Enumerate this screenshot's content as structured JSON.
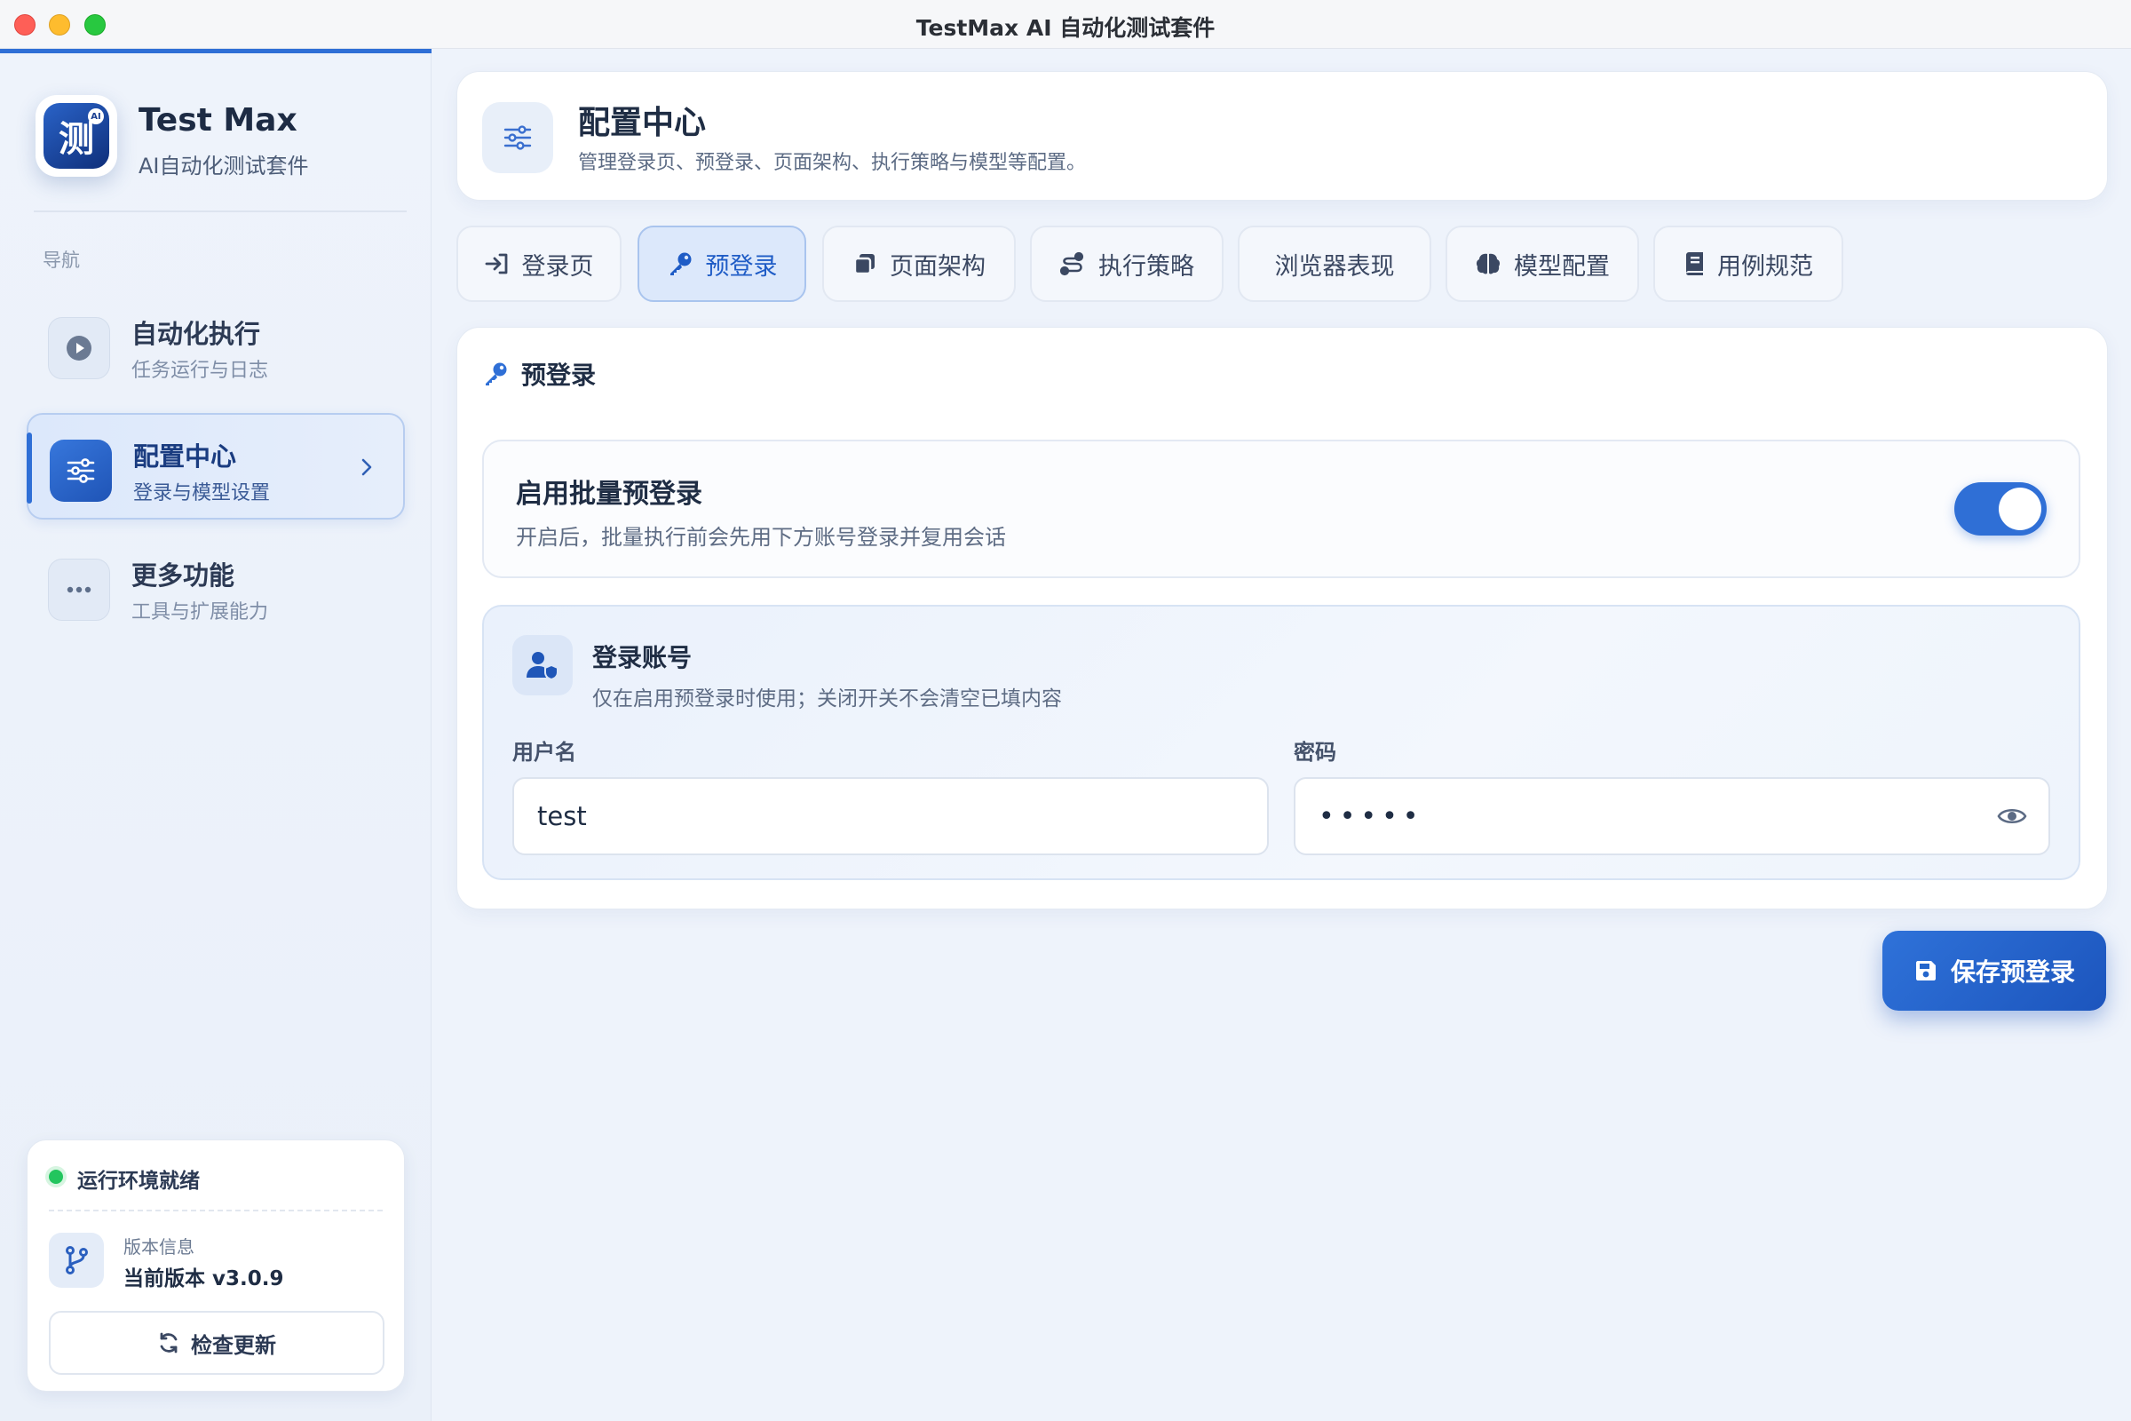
{
  "window": {
    "title": "TestMax AI 自动化测试套件"
  },
  "brand": {
    "name": "Test Max",
    "subtitle": "AI自动化测试套件",
    "logo_char": "测",
    "logo_badge": "AI"
  },
  "sidebar": {
    "heading": "导航",
    "items": [
      {
        "title": "自动化执行",
        "subtitle": "任务运行与日志",
        "icon": "play-icon"
      },
      {
        "title": "配置中心",
        "subtitle": "登录与模型设置",
        "icon": "sliders-icon",
        "active": true
      },
      {
        "title": "更多功能",
        "subtitle": "工具与扩展能力",
        "icon": "more-icon"
      }
    ],
    "status": {
      "text": "运行环境就绪",
      "version_label": "版本信息",
      "version_value": "当前版本 v3.0.9",
      "update_label": "检查更新"
    }
  },
  "header": {
    "title": "配置中心",
    "subtitle": "管理登录页、预登录、页面架构、执行策略与模型等配置。"
  },
  "tabs": [
    {
      "label": "登录页",
      "icon": "sign-in-icon"
    },
    {
      "label": "预登录",
      "icon": "key-icon",
      "active": true
    },
    {
      "label": "页面架构",
      "icon": "clone-icon"
    },
    {
      "label": "执行策略",
      "icon": "route-icon"
    },
    {
      "label": "浏览器表现",
      "icon": ""
    },
    {
      "label": "模型配置",
      "icon": "brain-icon"
    },
    {
      "label": "用例规范",
      "icon": "book-icon"
    }
  ],
  "prelogin": {
    "section_title": "预登录",
    "toggle": {
      "title": "启用批量预登录",
      "subtitle": "开启后，批量执行前会先用下方账号登录并复用会话",
      "enabled": true
    },
    "account": {
      "title": "登录账号",
      "subtitle": "仅在启用预登录时使用；关闭开关不会清空已填内容",
      "username_label": "用户名",
      "username_value": "test",
      "password_label": "密码",
      "password_value": "•••••"
    },
    "save_label": "保存预登录"
  },
  "colors": {
    "accent": "#2f6fd6",
    "status_ok": "#23c55e"
  }
}
